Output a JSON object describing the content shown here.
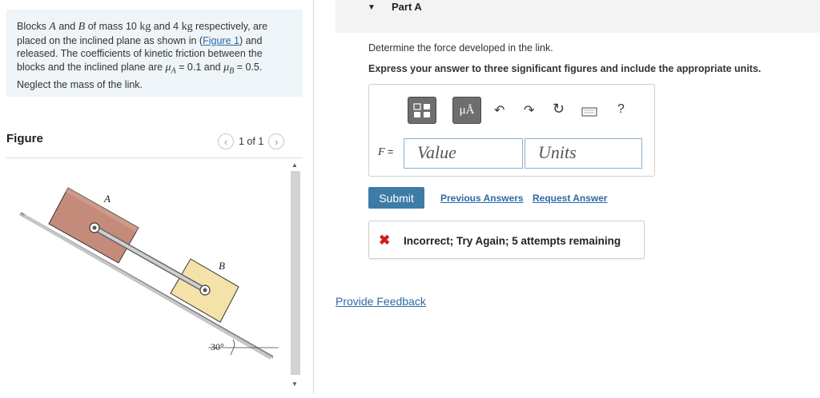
{
  "problem": {
    "t1": "Blocks ",
    "a": "A",
    "t2": " and ",
    "b": "B",
    "t3": " of mass 10 ",
    "kg1": "kg",
    "t4": " and 4 ",
    "kg2": "kg",
    "t5": " respectively, are placed on the inclined plane as shown in (",
    "figure_link": "Figure 1",
    "t6": ") and released. The coefficients of kinetic friction between the blocks and the inclined plane are ",
    "mu_a": "μ",
    "mu_a_sub": "A",
    "t7": " = 0.1 and ",
    "mu_b": "μ",
    "mu_b_sub": "B",
    "t8": " = 0.5. Neglect the mass of the link."
  },
  "figure": {
    "title": "Figure",
    "page": "1 of 1",
    "label_a": "A",
    "label_b": "B",
    "angle": "30°",
    "prev_icon": "chevron-left-icon",
    "next_icon": "chevron-right-icon"
  },
  "part": {
    "caret": "▼",
    "label": "Part A"
  },
  "question": "Determine the force developed in the link.",
  "instruction": "Express your answer to three significant figures and include the appropriate units.",
  "toolbar": {
    "units_btn": "μÅ",
    "help": "?",
    "undo_icon": "↶",
    "redo_icon": "↷",
    "reset_icon": "↻"
  },
  "answer": {
    "var": "F",
    "eq": " =",
    "value_placeholder": "Value",
    "units_placeholder": "Units"
  },
  "actions": {
    "submit": "Submit",
    "previous_answers": "Previous Answers",
    "request_answer": "Request Answer"
  },
  "feedback": {
    "icon": "✖",
    "text": "Incorrect; Try Again; 5 attempts remaining"
  },
  "provide_feedback": "Provide Feedback",
  "colors": {
    "accent": "#3c7ca6",
    "link": "#2d6aa3",
    "error": "#d11c1c",
    "block_a": "#c48a7a",
    "block_b": "#f5e2a8"
  }
}
